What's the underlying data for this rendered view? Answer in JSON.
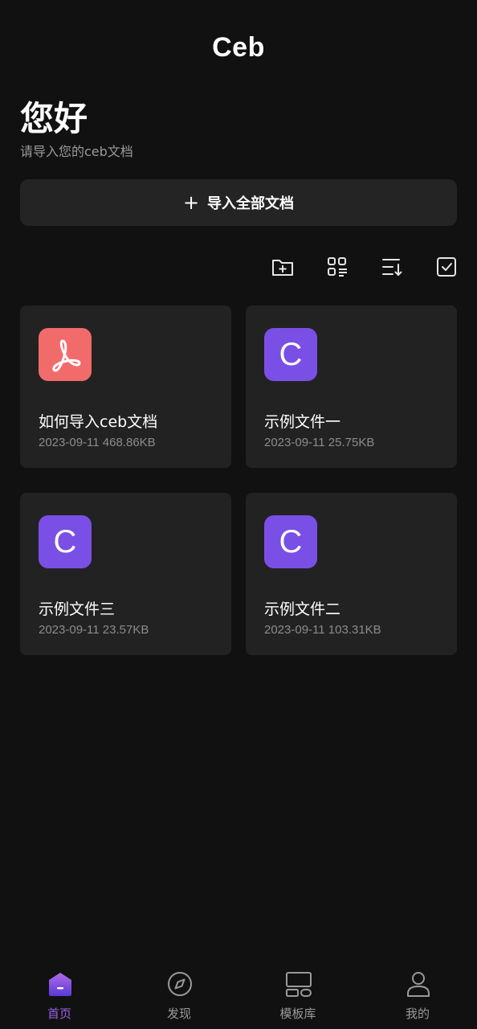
{
  "header": {
    "app_title": "Ceb",
    "greeting": "您好",
    "subtitle": "请导入您的ceb文档"
  },
  "import_button": {
    "icon": "plus-icon",
    "label": "导入全部文档"
  },
  "toolbar": {
    "icons": [
      "new-folder-icon",
      "grid-view-icon",
      "sort-icon",
      "select-checkbox-icon"
    ]
  },
  "files": [
    {
      "icon_type": "pdf",
      "icon_glyph": "",
      "name": "如何导入ceb文档",
      "meta": "2023-09-11 468.86KB"
    },
    {
      "icon_type": "ceb",
      "icon_glyph": "C",
      "name": "示例文件一",
      "meta": "2023-09-11 25.75KB"
    },
    {
      "icon_type": "ceb",
      "icon_glyph": "C",
      "name": "示例文件三",
      "meta": "2023-09-11 23.57KB"
    },
    {
      "icon_type": "ceb",
      "icon_glyph": "C",
      "name": "示例文件二",
      "meta": "2023-09-11 103.31KB"
    }
  ],
  "tabbar": {
    "tabs": [
      {
        "label": "首页",
        "icon": "home-icon",
        "active": true
      },
      {
        "label": "发现",
        "icon": "compass-icon",
        "active": false
      },
      {
        "label": "模板库",
        "icon": "template-icon",
        "active": false
      },
      {
        "label": "我的",
        "icon": "profile-icon",
        "active": false
      }
    ]
  },
  "colors": {
    "background": "#111111",
    "card": "#222222",
    "accent": "#9b62e8",
    "pdf_icon": "#f26b6b",
    "ceb_icon": "#7a4fe6"
  }
}
